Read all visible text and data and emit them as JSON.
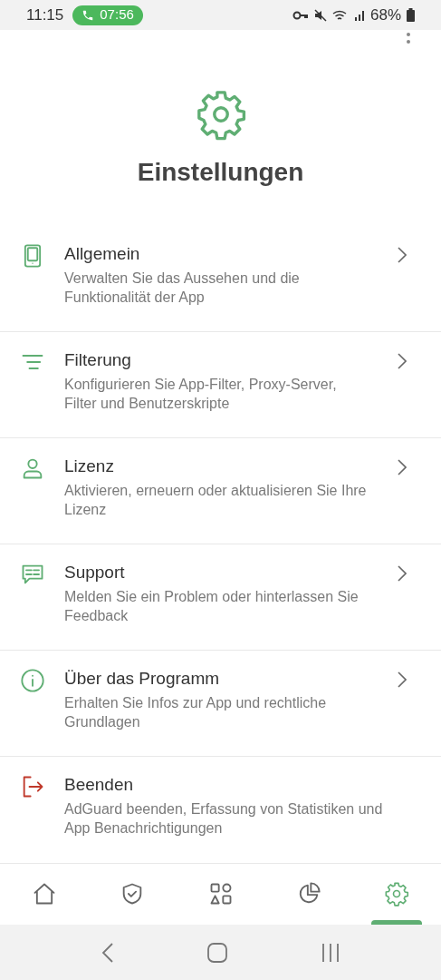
{
  "status_bar": {
    "time": "11:15",
    "call_timer": "07:56",
    "battery": "68%"
  },
  "header": {
    "title": "Einstellungen"
  },
  "items": [
    {
      "kind": "phone",
      "title": "Allgemein",
      "description": "Verwalten Sie das Aussehen und die Funktionalität der App",
      "chevron": true
    },
    {
      "kind": "filter",
      "title": "Filterung",
      "description": "Konfigurieren Sie App-Filter, Proxy-Server, Filter und Benutzerskripte",
      "chevron": true
    },
    {
      "kind": "user",
      "title": "Lizenz",
      "description": "Aktivieren, erneuern oder aktualisieren Sie Ihre Lizenz",
      "chevron": true
    },
    {
      "kind": "chat",
      "title": "Support",
      "description": "Melden Sie ein Problem oder hinterlassen Sie Feedback",
      "chevron": true
    },
    {
      "kind": "info",
      "title": "Über das Programm",
      "description": "Erhalten Sie Infos zur App und rechtliche Grundlagen",
      "chevron": true
    },
    {
      "kind": "exit",
      "title": "Beenden",
      "description": "AdGuard beenden, Erfassung von Statistiken und App Benachrichtigungen",
      "chevron": false
    }
  ],
  "bottom_nav": [
    {
      "kind": "home",
      "selected": false
    },
    {
      "kind": "shield",
      "selected": false
    },
    {
      "kind": "apps",
      "selected": false
    },
    {
      "kind": "stats",
      "selected": false
    },
    {
      "kind": "settings",
      "selected": true
    }
  ]
}
